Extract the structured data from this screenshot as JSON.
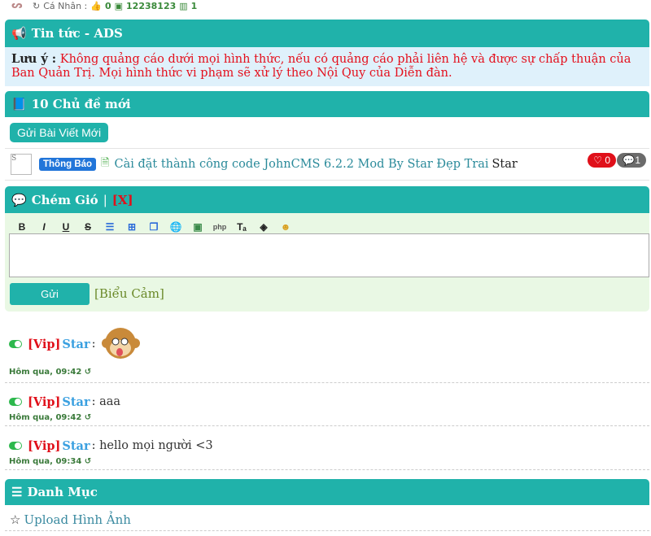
{
  "topbar": {
    "user_label": "Cá Nhân :",
    "thumb_count": "0",
    "id_number": "12238123",
    "stat_count": "1"
  },
  "news": {
    "header": "Tin tức - ADS",
    "notice_label": "Lưu ý :",
    "notice_text": "Không quảng cáo dưới mọi hình thức, nếu có quảng cáo phải liên hệ và được sự chấp thuận của Ban Quản Trị. Mọi hình thức vi phạm sẽ xử lý theo Nội Quy của Diễn đàn."
  },
  "topics": {
    "header": "10 Chủ đề mới",
    "post_button": "Gửi Bài Viết Mới",
    "items": [
      {
        "badge": "Thông Báo",
        "title": "Cài đặt thành công code JohnCMS 6.2.2 Mod By Star Đẹp Trai",
        "author": "Star",
        "likes": "0",
        "comments": "1",
        "avatar_alt": "S"
      }
    ]
  },
  "chat": {
    "header": "Chém Gió",
    "separator": "|",
    "close": "[X]",
    "send_label": "Gửi",
    "emoticon_link": "[Biểu Cảm]",
    "tools": [
      "B",
      "I",
      "U",
      "S",
      "list-icon",
      "plus-icon",
      "copy-icon",
      "globe-icon",
      "image-icon",
      "php-icon",
      "text-color-icon",
      "fill-icon",
      "smiley-icon"
    ],
    "messages": [
      {
        "vip": "[Vip]",
        "user": "Star",
        "text": ":",
        "time": "Hôm qua, 09:42"
      },
      {
        "vip": "[Vip]",
        "user": "Star",
        "text": ": aaa",
        "time": "Hôm qua, 09:42"
      },
      {
        "vip": "[Vip]",
        "user": "Star",
        "text": ": hello mọi người <3",
        "time": "Hôm qua, 09:34"
      }
    ]
  },
  "category": {
    "header": "Danh Mục",
    "items": [
      {
        "label": "Upload Hình Ảnh"
      }
    ]
  },
  "colors": {
    "accent": "#20b2aa",
    "notice_red": "#e4101d",
    "vip_red": "#e0101a",
    "user_blue": "#3aa0e0"
  }
}
